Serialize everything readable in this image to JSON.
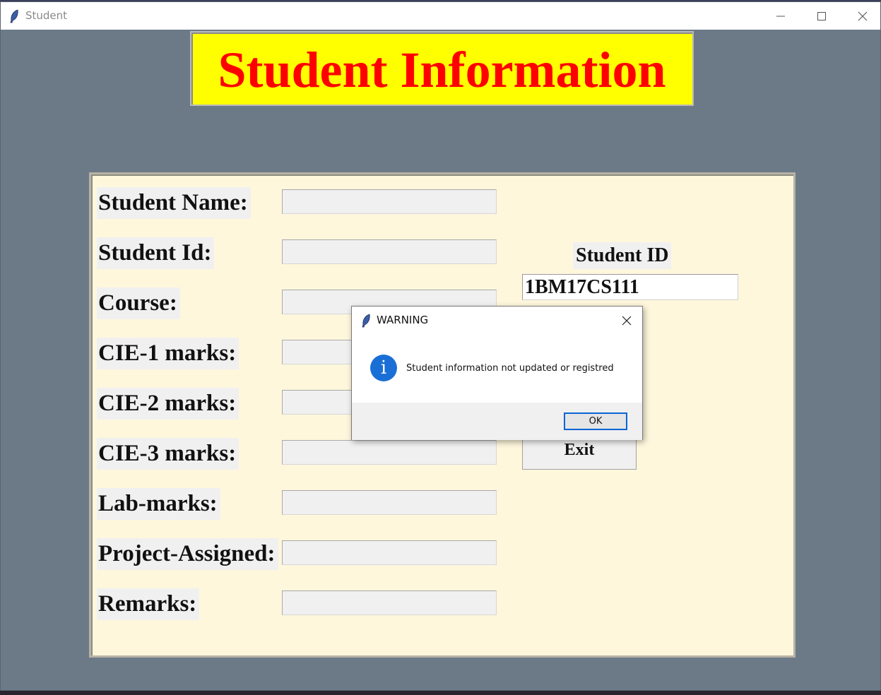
{
  "window": {
    "title": "Student"
  },
  "banner": {
    "title": "Student Information"
  },
  "form": {
    "fields": [
      {
        "label": "Student Name:",
        "value": ""
      },
      {
        "label": "Student Id:",
        "value": ""
      },
      {
        "label": "Course:",
        "value": ""
      },
      {
        "label": "CIE-1 marks:",
        "value": ""
      },
      {
        "label": "CIE-2 marks:",
        "value": ""
      },
      {
        "label": "CIE-3 marks:",
        "value": ""
      },
      {
        "label": "Lab-marks:",
        "value": ""
      },
      {
        "label": "Project-Assigned:",
        "value": ""
      },
      {
        "label": "Remarks:",
        "value": ""
      }
    ]
  },
  "lookup": {
    "label": "Student ID",
    "value": "1BM17CS111",
    "exit_label": "Exit"
  },
  "dialog": {
    "title": "WARNING",
    "message": "Student information not updated or registred",
    "ok_label": "OK"
  },
  "colors": {
    "background": "#6c7a88",
    "banner_bg": "#ffff00",
    "banner_text": "#ff0000",
    "panel_bg": "#fff7dc",
    "info_icon": "#1a6fd6"
  }
}
